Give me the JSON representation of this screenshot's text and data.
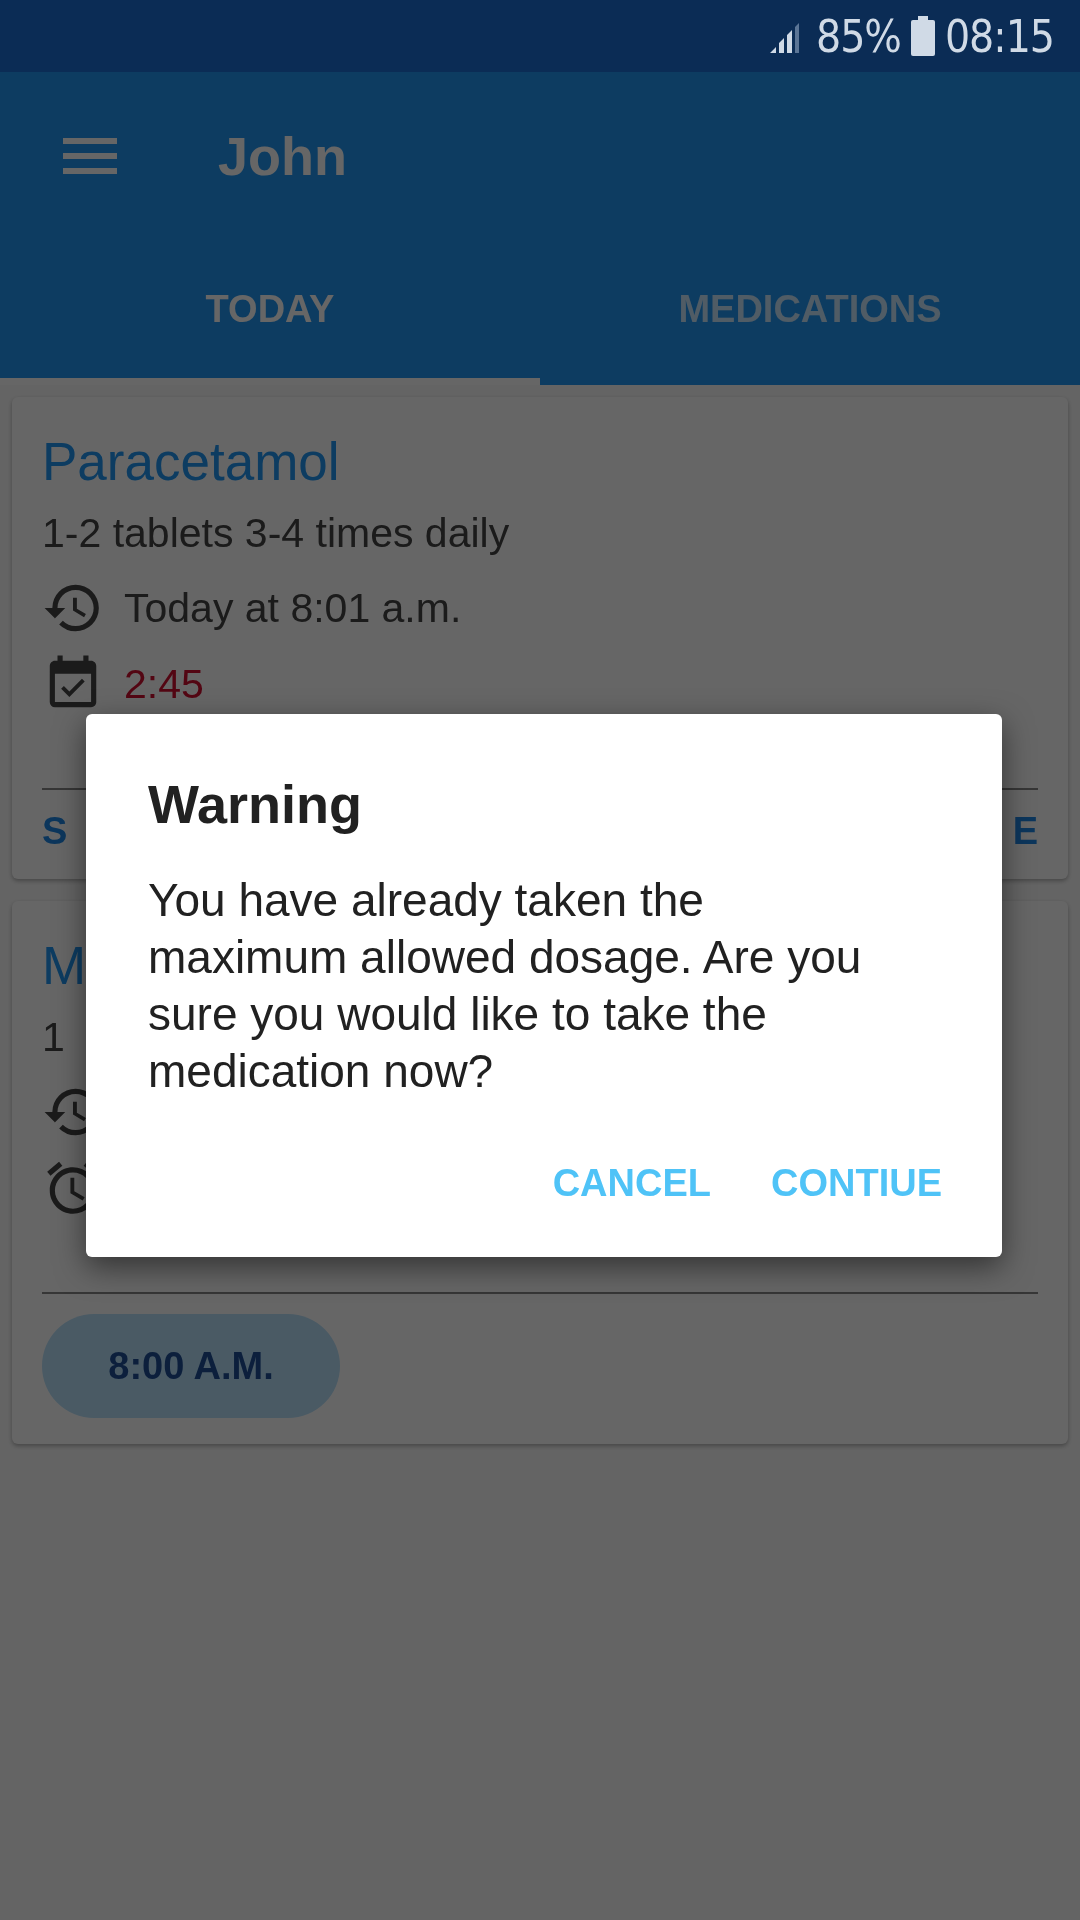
{
  "status_bar": {
    "battery": "85%",
    "time": "08:15"
  },
  "app_bar": {
    "title": "John"
  },
  "tabs": [
    {
      "label": "TODAY",
      "selected": true
    },
    {
      "label": "MEDICATIONS",
      "selected": false
    }
  ],
  "cards": [
    {
      "title": "Paracetamol",
      "dosage": "1-2 tablets 3-4 times daily",
      "rows": [
        {
          "kind": "last_taken",
          "text": "Today at 8:01 a.m."
        },
        {
          "kind": "next_dose",
          "text": "2:45",
          "overdue": true
        }
      ],
      "footer": {
        "kind": "actions",
        "items": [
          "S",
          "E"
        ]
      }
    },
    {
      "title": "M",
      "dosage": "1",
      "rows": [
        {
          "kind": "last_taken"
        },
        {
          "kind": "alarm"
        }
      ],
      "footer": {
        "kind": "times",
        "items": [
          "8:00 A.M."
        ]
      }
    }
  ],
  "dialog": {
    "title": "Warning",
    "message": "You have already taken the maximum allowed dosage. Are you sure you would like to take the medication now?",
    "buttons": [
      "CANCEL",
      "CONTIUE"
    ]
  }
}
